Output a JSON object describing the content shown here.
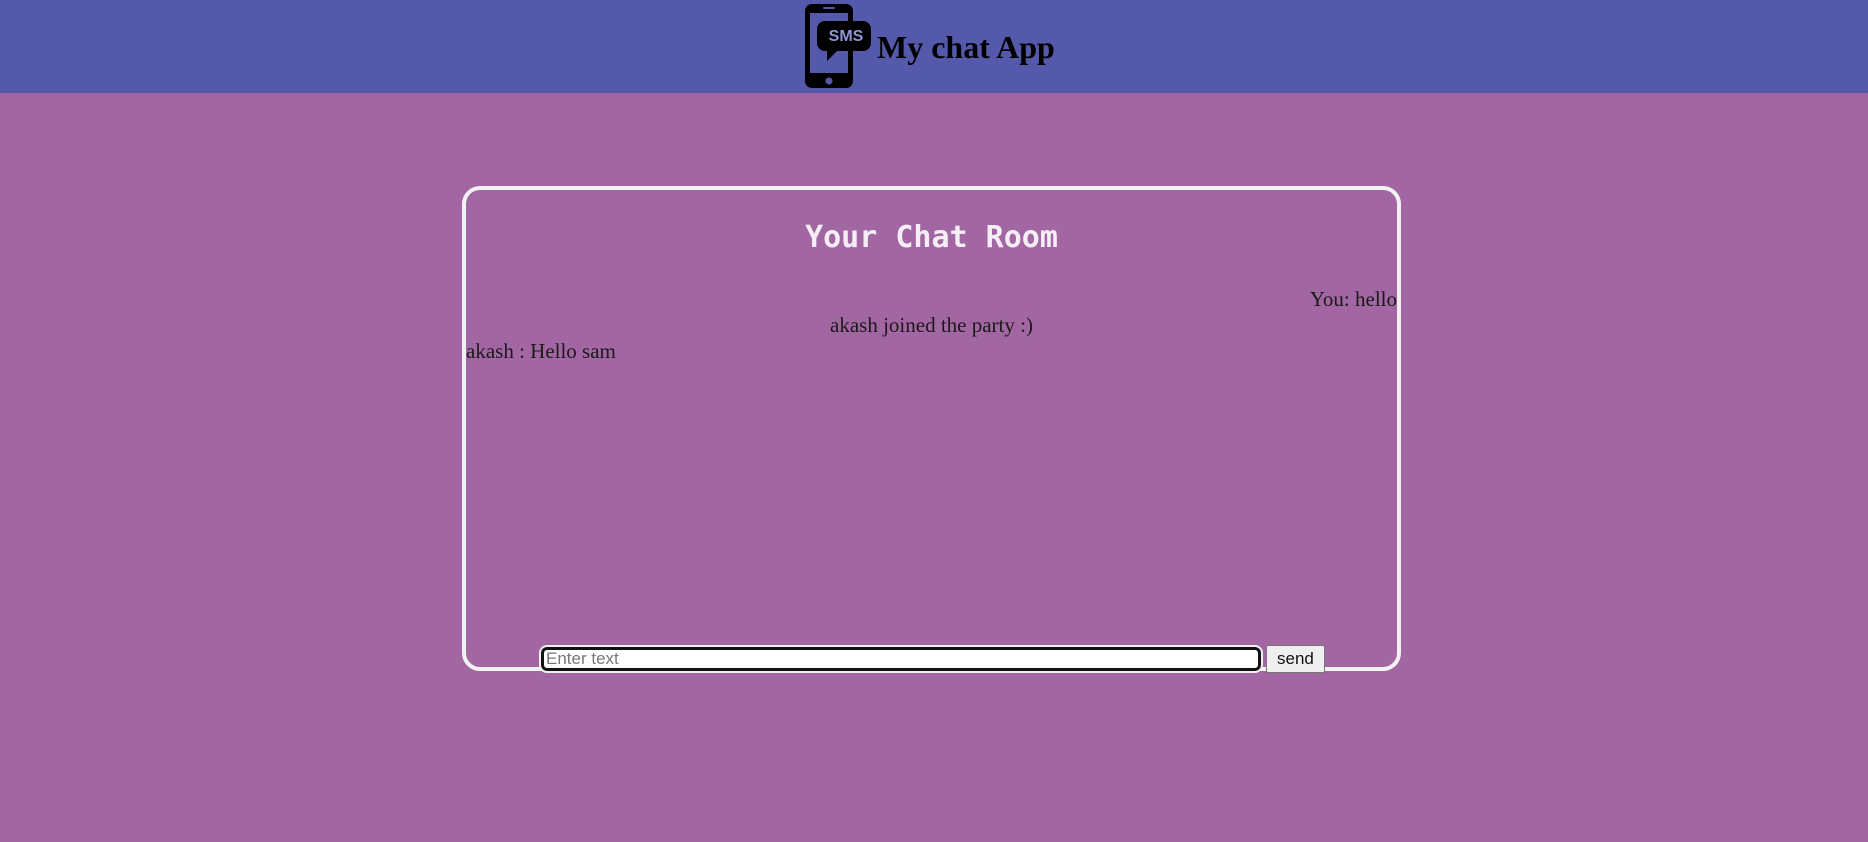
{
  "header": {
    "app_title": "My chat App",
    "logo": {
      "icon": "phone-sms-icon",
      "badge_text": "SMS"
    }
  },
  "chat_room": {
    "title": "Your Chat Room",
    "messages": [
      {
        "text": "You: hello",
        "align": "right"
      },
      {
        "text": "akash joined the party :)",
        "align": "center"
      },
      {
        "text": "akash : Hello sam",
        "align": "left"
      }
    ],
    "composer": {
      "input_value": "",
      "input_placeholder": "Enter text",
      "send_label": "send"
    }
  },
  "colors": {
    "header_bg": "#5559ab",
    "page_bg": "#a266a3",
    "room_border": "#f2f2f2"
  }
}
